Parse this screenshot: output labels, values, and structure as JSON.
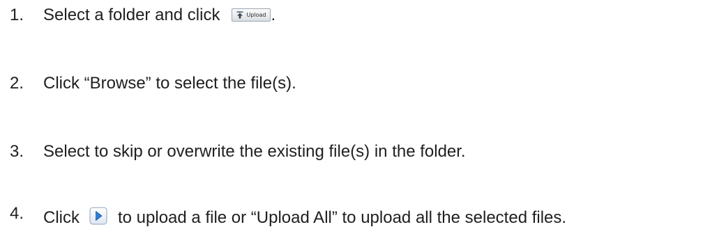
{
  "steps": [
    {
      "number": "1.",
      "text_before": "Select a folder and click",
      "button_label": "Upload",
      "text_after": "."
    },
    {
      "number": "2.",
      "text": "Click “Browse” to select the file(s)."
    },
    {
      "number": "3.",
      "text": "Select to skip or overwrite the existing file(s) in the folder."
    },
    {
      "number": "4.",
      "text_before": "Click",
      "icon": "play-upload-icon",
      "text_after": "to upload a file or “Upload All” to upload all the selected files."
    }
  ],
  "colors": {
    "text": "#1f1f1f",
    "icon_blue": "#2f7fd6",
    "button_border": "#9aa6b3"
  }
}
